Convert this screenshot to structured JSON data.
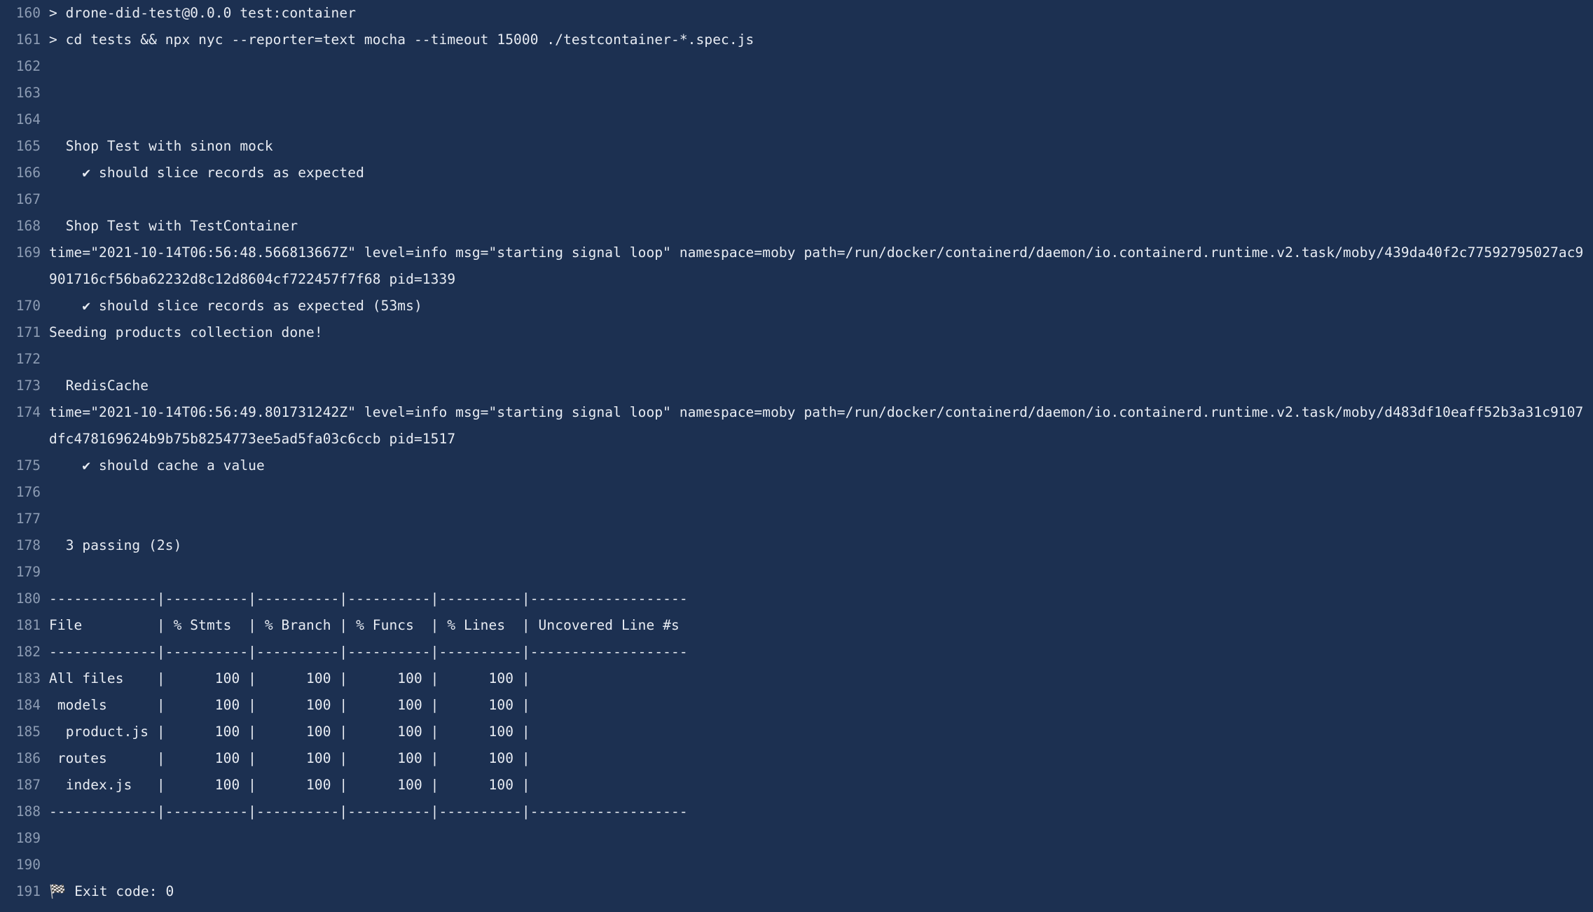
{
  "viewer": {
    "type": "ci-build-log",
    "background_color": "#1c3051",
    "text_color": "#e8ecf3",
    "line_number_color": "#8d9cb3"
  },
  "lines": [
    {
      "n": "160",
      "text": "> drone-did-test@0.0.0 test:container"
    },
    {
      "n": "161",
      "text": "> cd tests && npx nyc --reporter=text mocha --timeout 15000 ./testcontainer-*.spec.js"
    },
    {
      "n": "162",
      "text": ""
    },
    {
      "n": "163",
      "text": ""
    },
    {
      "n": "164",
      "text": ""
    },
    {
      "n": "165",
      "text": "  Shop Test with sinon mock"
    },
    {
      "n": "166",
      "text": "    ✔ should slice records as expected"
    },
    {
      "n": "167",
      "text": ""
    },
    {
      "n": "168",
      "text": "  Shop Test with TestContainer"
    },
    {
      "n": "169",
      "text": "time=\"2021-10-14T06:56:48.566813667Z\" level=info msg=\"starting signal loop\" namespace=moby path=/run/docker/containerd/daemon/io.containerd.runtime.v2.task/moby/439da40f2c77592795027ac9901716cf56ba62232d8c12d8604cf722457f7f68 pid=1339"
    },
    {
      "n": "170",
      "text": "    ✔ should slice records as expected (53ms)"
    },
    {
      "n": "171",
      "text": "Seeding products collection done!"
    },
    {
      "n": "172",
      "text": ""
    },
    {
      "n": "173",
      "text": "  RedisCache"
    },
    {
      "n": "174",
      "text": "time=\"2021-10-14T06:56:49.801731242Z\" level=info msg=\"starting signal loop\" namespace=moby path=/run/docker/containerd/daemon/io.containerd.runtime.v2.task/moby/d483df10eaff52b3a31c9107dfc478169624b9b75b8254773ee5ad5fa03c6ccb pid=1517"
    },
    {
      "n": "175",
      "text": "    ✔ should cache a value"
    },
    {
      "n": "176",
      "text": ""
    },
    {
      "n": "177",
      "text": ""
    },
    {
      "n": "178",
      "text": "  3 passing (2s)"
    },
    {
      "n": "179",
      "text": ""
    },
    {
      "n": "180",
      "text": "-------------|----------|----------|----------|----------|-------------------"
    },
    {
      "n": "181",
      "text": "File         | % Stmts  | % Branch | % Funcs  | % Lines  | Uncovered Line #s"
    },
    {
      "n": "182",
      "text": "-------------|----------|----------|----------|----------|-------------------"
    },
    {
      "n": "183",
      "text": "All files    |      100 |      100 |      100 |      100 |"
    },
    {
      "n": "184",
      "text": " models      |      100 |      100 |      100 |      100 |"
    },
    {
      "n": "185",
      "text": "  product.js |      100 |      100 |      100 |      100 |"
    },
    {
      "n": "186",
      "text": " routes      |      100 |      100 |      100 |      100 |"
    },
    {
      "n": "187",
      "text": "  index.js   |      100 |      100 |      100 |      100 |"
    },
    {
      "n": "188",
      "text": "-------------|----------|----------|----------|----------|-------------------"
    },
    {
      "n": "189",
      "text": ""
    },
    {
      "n": "190",
      "text": ""
    },
    {
      "n": "191",
      "text": "🏁 Exit code: 0"
    }
  ],
  "summary": {
    "package": "drone-did-test@0.0.0",
    "script_name": "test:container",
    "command": "cd tests && npx nyc --reporter=text mocha --timeout 15000 ./testcontainer-*.spec.js",
    "suites": [
      {
        "name": "Shop Test with sinon mock",
        "tests": [
          "should slice records as expected"
        ]
      },
      {
        "name": "Shop Test with TestContainer",
        "tests": [
          "should slice records as expected (53ms)"
        ]
      },
      {
        "name": "RedisCache",
        "tests": [
          "should cache a value"
        ]
      }
    ],
    "passing": "3 passing (2s)",
    "exit_code": "0",
    "exit_label": "Exit code: 0"
  },
  "coverage_table": {
    "headers": [
      "File",
      "% Stmts",
      "% Branch",
      "% Funcs",
      "% Lines",
      "Uncovered Line #s"
    ],
    "rows": [
      [
        "All files",
        "100",
        "100",
        "100",
        "100",
        ""
      ],
      [
        "models",
        "100",
        "100",
        "100",
        "100",
        ""
      ],
      [
        "product.js",
        "100",
        "100",
        "100",
        "100",
        ""
      ],
      [
        "routes",
        "100",
        "100",
        "100",
        "100",
        ""
      ],
      [
        "index.js",
        "100",
        "100",
        "100",
        "100",
        ""
      ]
    ]
  },
  "docker_events": [
    {
      "time": "2021-10-14T06:56:48.566813667Z",
      "level": "info",
      "msg": "starting signal loop",
      "namespace": "moby",
      "path": "/run/docker/containerd/daemon/io.containerd.runtime.v2.task/moby/439da40f2c77592795027ac9901716cf56ba62232d8c12d8604cf722457f7f68",
      "pid": "1339"
    },
    {
      "time": "2021-10-14T06:56:49.801731242Z",
      "level": "info",
      "msg": "starting signal loop",
      "namespace": "moby",
      "path": "/run/docker/containerd/daemon/io.containerd.runtime.v2.task/moby/d483df10eaff52b3a31c9107dfc478169624b9b75b8254773ee5ad5fa03c6ccb",
      "pid": "1517"
    }
  ]
}
